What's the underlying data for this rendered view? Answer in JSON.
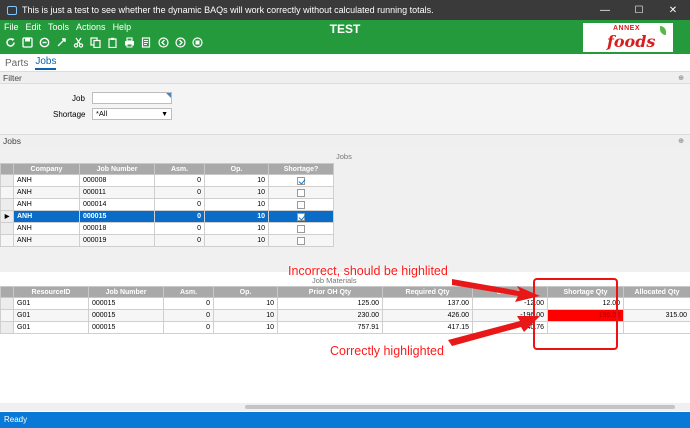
{
  "window": {
    "title": "This is just a test to see whether the dynamic BAQs will work correctly without calculated running totals.",
    "minimize": "—",
    "maximize": "☐",
    "close": "✕"
  },
  "menu": [
    "File",
    "Edit",
    "Tools",
    "Actions",
    "Help"
  ],
  "app_name": "TEST",
  "logo": {
    "top": "ANNEX",
    "main": "foods"
  },
  "toolbar_icons": [
    "refresh-icon",
    "save-icon",
    "clear-icon",
    "delete-icon",
    "cut-icon",
    "copy-icon",
    "paste-icon",
    "print-icon",
    "print-preview-icon",
    "back-icon",
    "forward-icon",
    "stop-icon"
  ],
  "tabs": [
    {
      "label": "Parts",
      "active": false
    },
    {
      "label": "Jobs",
      "active": true
    }
  ],
  "filter": {
    "header": "Filter",
    "job_label": "Job",
    "job_value": "",
    "shortage_label": "Shortage",
    "shortage_value": "*All"
  },
  "jobs": {
    "header": "Jobs",
    "grid_caption": "Jobs",
    "columns": [
      "Company",
      "Job Number",
      "Asm.",
      "Op.",
      "Shortage?"
    ],
    "rows": [
      {
        "company": "ANH",
        "job": "000008",
        "asm": "0",
        "op": "10",
        "shortage": true,
        "selected": false
      },
      {
        "company": "ANH",
        "job": "000011",
        "asm": "0",
        "op": "10",
        "shortage": false,
        "selected": false
      },
      {
        "company": "ANH",
        "job": "000014",
        "asm": "0",
        "op": "10",
        "shortage": false,
        "selected": false
      },
      {
        "company": "ANH",
        "job": "000015",
        "asm": "0",
        "op": "10",
        "shortage": true,
        "selected": true
      },
      {
        "company": "ANH",
        "job": "000018",
        "asm": "0",
        "op": "10",
        "shortage": false,
        "selected": false
      },
      {
        "company": "ANH",
        "job": "000019",
        "asm": "0",
        "op": "10",
        "shortage": false,
        "selected": false
      }
    ]
  },
  "materials": {
    "grid_caption": "Job Materials",
    "columns": [
      "ResourceID",
      "Job Number",
      "Asm.",
      "Op.",
      "Prior OH Qty",
      "Required Qty",
      "OnHand",
      "Shortage Qty",
      "Allocated Qty"
    ],
    "rows": [
      {
        "resource": "G01",
        "job": "000015",
        "asm": "0",
        "op": "10",
        "prior": "125.00",
        "required": "137.00",
        "onhand": "-12.00",
        "shortage": "12.00",
        "allocated": ""
      },
      {
        "resource": "G01",
        "job": "000015",
        "asm": "0",
        "op": "10",
        "prior": "230.00",
        "required": "426.00",
        "onhand": "-196.00",
        "shortage": "196.00",
        "allocated": "315.00"
      },
      {
        "resource": "G01",
        "job": "000015",
        "asm": "0",
        "op": "10",
        "prior": "757.91",
        "required": "417.15",
        "onhand": "340.76",
        "shortage": "",
        "allocated": ""
      }
    ]
  },
  "annotations": {
    "incorrect": "Incorrect, should be highlited",
    "correct": "Correctly highlighted",
    "color": "#ff1a1a"
  },
  "status": "Ready",
  "colors": {
    "green_bar": "#249a3c",
    "selected_row": "#0a6cc6",
    "status_bar": "#0a78d6",
    "highlight": "#ff0000"
  }
}
